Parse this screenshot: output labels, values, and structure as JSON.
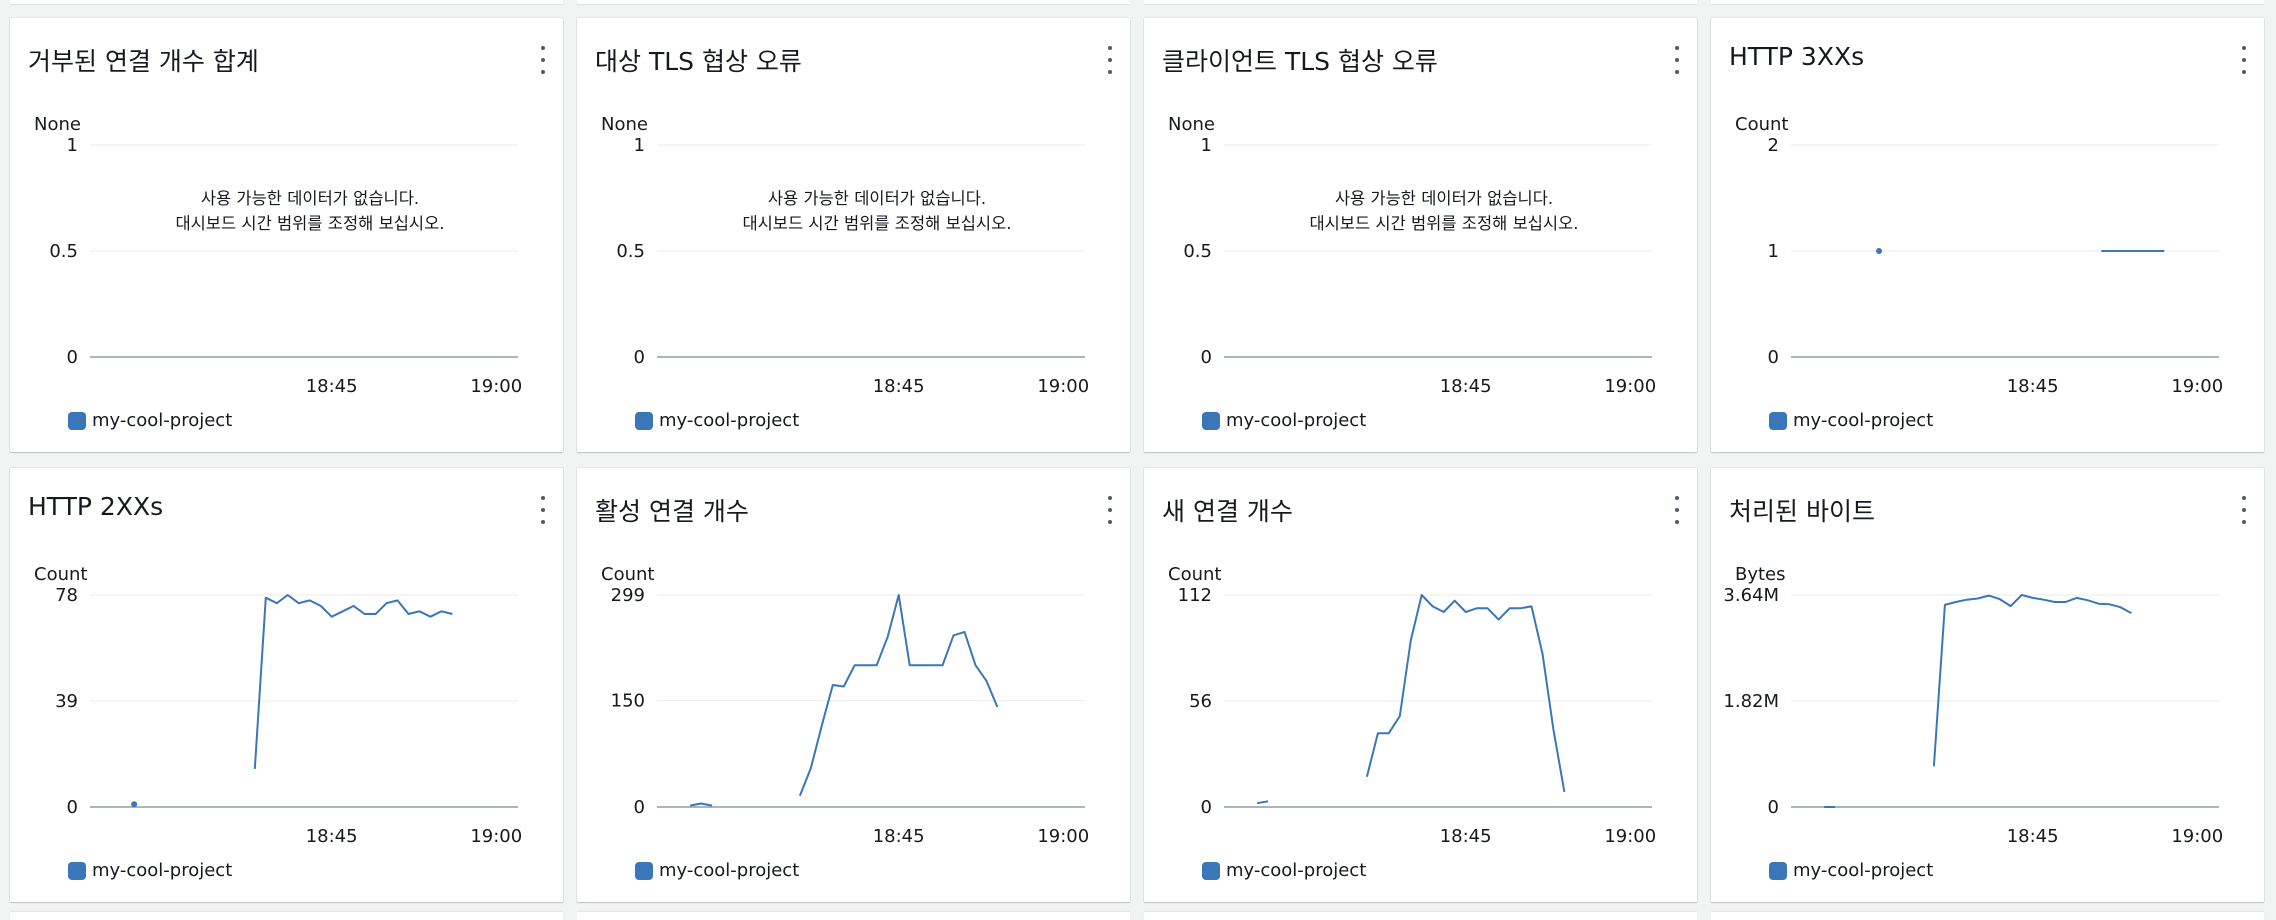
{
  "series_color": "#3a77b8",
  "grid_color": "#e9ebed",
  "axis_color": "#aab7b8",
  "icons": {
    "more": "kebab-vertical-icon"
  },
  "widgets": [
    {
      "title": "거부된 연결 개수 합계",
      "unit": "None",
      "no_data_line1": "사용 가능한 데이터가 없습니다.",
      "no_data_line2": "대시보드 시간 범위를 조정해 보십시오.",
      "legend": "my-cool-project"
    },
    {
      "title": "대상 TLS 협상 오류",
      "unit": "None",
      "no_data_line1": "사용 가능한 데이터가 없습니다.",
      "no_data_line2": "대시보드 시간 범위를 조정해 보십시오.",
      "legend": "my-cool-project"
    },
    {
      "title": "클라이언트 TLS 협상 오류",
      "unit": "None",
      "no_data_line1": "사용 가능한 데이터가 없습니다.",
      "no_data_line2": "대시보드 시간 범위를 조정해 보십시오.",
      "legend": "my-cool-project"
    },
    {
      "title": "HTTP 3XXs",
      "unit": "Count",
      "legend": "my-cool-project"
    },
    {
      "title": "HTTP 2XXs",
      "unit": "Count",
      "legend": "my-cool-project"
    },
    {
      "title": "활성 연결 개수",
      "unit": "Count",
      "legend": "my-cool-project"
    },
    {
      "title": "새 연결 개수",
      "unit": "Count",
      "legend": "my-cool-project"
    },
    {
      "title": "처리된 바이트",
      "unit": "Bytes",
      "legend": "my-cool-project"
    }
  ],
  "chart_data": [
    {
      "type": "line",
      "title": "거부된 연결 개수 합계",
      "ylabel": "None",
      "ylim": [
        0,
        1
      ],
      "yticks": [
        {
          "v": 0,
          "label": "0"
        },
        {
          "v": 0.5,
          "label": "0.5"
        },
        {
          "v": 1,
          "label": "1"
        }
      ],
      "xlim": [
        18.383,
        19.033
      ],
      "xticks": [
        {
          "v": 18.75,
          "label": "18:45"
        },
        {
          "v": 19.0,
          "label": "19:00"
        }
      ],
      "series": [
        {
          "name": "my-cool-project",
          "segments": []
        }
      ]
    },
    {
      "type": "line",
      "title": "대상 TLS 협상 오류",
      "ylabel": "None",
      "ylim": [
        0,
        1
      ],
      "yticks": [
        {
          "v": 0,
          "label": "0"
        },
        {
          "v": 0.5,
          "label": "0.5"
        },
        {
          "v": 1,
          "label": "1"
        }
      ],
      "xlim": [
        18.383,
        19.033
      ],
      "xticks": [
        {
          "v": 18.75,
          "label": "18:45"
        },
        {
          "v": 19.0,
          "label": "19:00"
        }
      ],
      "series": [
        {
          "name": "my-cool-project",
          "segments": []
        }
      ]
    },
    {
      "type": "line",
      "title": "클라이언트 TLS 협상 오류",
      "ylabel": "None",
      "ylim": [
        0,
        1
      ],
      "yticks": [
        {
          "v": 0,
          "label": "0"
        },
        {
          "v": 0.5,
          "label": "0.5"
        },
        {
          "v": 1,
          "label": "1"
        }
      ],
      "xlim": [
        18.383,
        19.033
      ],
      "xticks": [
        {
          "v": 18.75,
          "label": "18:45"
        },
        {
          "v": 19.0,
          "label": "19:00"
        }
      ],
      "series": [
        {
          "name": "my-cool-project",
          "segments": []
        }
      ]
    },
    {
      "type": "line",
      "title": "HTTP 3XXs",
      "ylabel": "Count",
      "ylim": [
        0,
        2
      ],
      "yticks": [
        {
          "v": 0,
          "label": "0"
        },
        {
          "v": 1,
          "label": "1"
        },
        {
          "v": 2,
          "label": "2"
        }
      ],
      "xlim": [
        18.383,
        19.033
      ],
      "xticks": [
        {
          "v": 18.75,
          "label": "18:45"
        },
        {
          "v": 19.0,
          "label": "19:00"
        }
      ],
      "series": [
        {
          "name": "my-cool-project",
          "segments": [
            [
              [
                18.5167,
                1
              ]
            ],
            [
              [
                18.8542,
                1
              ],
              [
                18.95,
                1
              ]
            ]
          ]
        }
      ]
    },
    {
      "type": "line",
      "title": "HTTP 2XXs",
      "ylabel": "Count",
      "ylim": [
        0,
        78
      ],
      "yticks": [
        {
          "v": 0,
          "label": "0"
        },
        {
          "v": 39,
          "label": "39"
        },
        {
          "v": 78,
          "label": "78"
        }
      ],
      "xlim": [
        18.383,
        19.033
      ],
      "xticks": [
        {
          "v": 18.75,
          "label": "18:45"
        },
        {
          "v": 19.0,
          "label": "19:00"
        }
      ],
      "series": [
        {
          "name": "my-cool-project",
          "segments": [
            [
              [
                18.45,
                1
              ]
            ],
            [
              [
                18.6333,
                14
              ],
              [
                18.65,
                77
              ],
              [
                18.6667,
                75
              ],
              [
                18.6833,
                78
              ],
              [
                18.7,
                75
              ],
              [
                18.7167,
                76
              ],
              [
                18.7333,
                74
              ],
              [
                18.75,
                70
              ],
              [
                18.7667,
                72
              ],
              [
                18.7833,
                74
              ],
              [
                18.8,
                71
              ],
              [
                18.8167,
                71
              ],
              [
                18.8333,
                75
              ],
              [
                18.85,
                76
              ],
              [
                18.8667,
                71
              ],
              [
                18.8833,
                72
              ],
              [
                18.9,
                70
              ],
              [
                18.9167,
                72
              ],
              [
                18.9333,
                71
              ]
            ]
          ]
        }
      ]
    },
    {
      "type": "line",
      "title": "활성 연결 개수",
      "ylabel": "Count",
      "ylim": [
        0,
        299
      ],
      "yticks": [
        {
          "v": 0,
          "label": "0"
        },
        {
          "v": 150,
          "label": "150"
        },
        {
          "v": 299,
          "label": "299"
        }
      ],
      "xlim": [
        18.383,
        19.033
      ],
      "xticks": [
        {
          "v": 18.75,
          "label": "18:45"
        },
        {
          "v": 19.0,
          "label": "19:00"
        }
      ],
      "series": [
        {
          "name": "my-cool-project",
          "segments": [
            [
              [
                18.4333,
                2
              ],
              [
                18.45,
                5
              ],
              [
                18.4667,
                2
              ]
            ],
            [
              [
                18.6,
                16
              ],
              [
                18.6167,
                55
              ],
              [
                18.6333,
                115
              ],
              [
                18.65,
                172
              ],
              [
                18.6667,
                170
              ],
              [
                18.6833,
                200
              ],
              [
                18.7,
                200
              ],
              [
                18.7167,
                200
              ],
              [
                18.7333,
                240
              ],
              [
                18.75,
                299
              ],
              [
                18.7667,
                200
              ],
              [
                18.7833,
                200
              ],
              [
                18.8,
                200
              ],
              [
                18.8167,
                200
              ],
              [
                18.8333,
                242
              ],
              [
                18.85,
                247
              ],
              [
                18.8667,
                200
              ],
              [
                18.8833,
                178
              ],
              [
                18.9,
                141
              ]
            ]
          ]
        }
      ]
    },
    {
      "type": "line",
      "title": "새 연결 개수",
      "ylabel": "Count",
      "ylim": [
        0,
        112
      ],
      "yticks": [
        {
          "v": 0,
          "label": "0"
        },
        {
          "v": 56,
          "label": "56"
        },
        {
          "v": 112,
          "label": "112"
        }
      ],
      "xlim": [
        18.383,
        19.033
      ],
      "xticks": [
        {
          "v": 18.75,
          "label": "18:45"
        },
        {
          "v": 19.0,
          "label": "19:00"
        }
      ],
      "series": [
        {
          "name": "my-cool-project",
          "segments": [
            [
              [
                18.4333,
                2
              ],
              [
                18.45,
                3
              ]
            ],
            [
              [
                18.6,
                16
              ],
              [
                18.6167,
                39
              ],
              [
                18.6333,
                39
              ],
              [
                18.65,
                48
              ],
              [
                18.6667,
                88
              ],
              [
                18.6833,
                112
              ],
              [
                18.7,
                106
              ],
              [
                18.7167,
                103
              ],
              [
                18.7333,
                109
              ],
              [
                18.75,
                103
              ],
              [
                18.7667,
                105
              ],
              [
                18.7833,
                105
              ],
              [
                18.8,
                99
              ],
              [
                18.8167,
                105
              ],
              [
                18.8333,
                105
              ],
              [
                18.85,
                106
              ],
              [
                18.8667,
                81
              ],
              [
                18.8833,
                41
              ],
              [
                18.9,
                8
              ]
            ]
          ]
        }
      ]
    },
    {
      "type": "line",
      "title": "처리된 바이트",
      "ylabel": "Bytes",
      "ylim": [
        0,
        3.64
      ],
      "yunit": "M",
      "yticks": [
        {
          "v": 0,
          "label": "0"
        },
        {
          "v": 1.82,
          "label": "1.82M"
        },
        {
          "v": 3.64,
          "label": "3.64M"
        }
      ],
      "xlim": [
        18.383,
        19.033
      ],
      "xticks": [
        {
          "v": 18.75,
          "label": "18:45"
        },
        {
          "v": 19.0,
          "label": "19:00"
        }
      ],
      "series": [
        {
          "name": "my-cool-project",
          "segments": [
            [
              [
                18.4333,
                0
              ],
              [
                18.45,
                0
              ]
            ],
            [
              [
                18.6,
                0.7
              ],
              [
                18.6167,
                3.47
              ],
              [
                18.6333,
                3.52
              ],
              [
                18.65,
                3.56
              ],
              [
                18.6667,
                3.58
              ],
              [
                18.6833,
                3.63
              ],
              [
                18.7,
                3.57
              ],
              [
                18.7167,
                3.45
              ],
              [
                18.7333,
                3.64
              ],
              [
                18.75,
                3.59
              ],
              [
                18.7667,
                3.56
              ],
              [
                18.7833,
                3.52
              ],
              [
                18.8,
                3.52
              ],
              [
                18.8167,
                3.59
              ],
              [
                18.8333,
                3.55
              ],
              [
                18.85,
                3.49
              ],
              [
                18.8667,
                3.48
              ],
              [
                18.8833,
                3.43
              ],
              [
                18.9,
                3.33
              ]
            ]
          ]
        }
      ]
    }
  ]
}
